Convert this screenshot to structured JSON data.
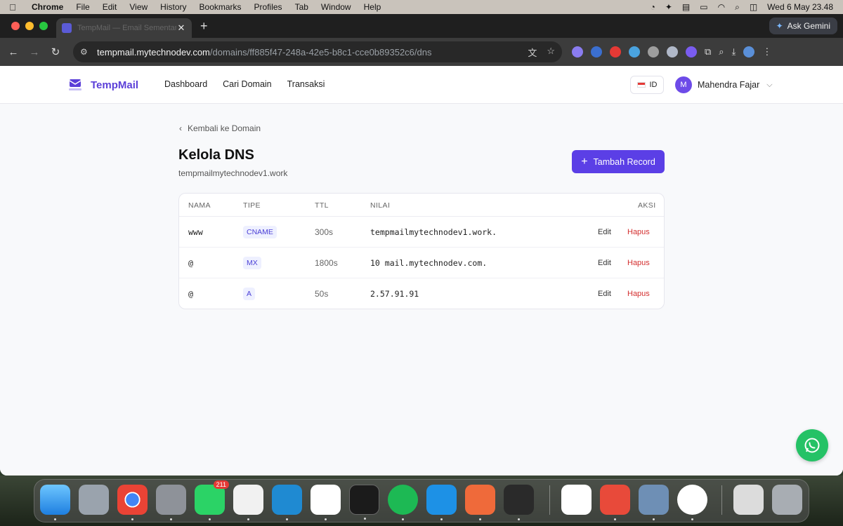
{
  "menubar": {
    "app_name": "Chrome",
    "items": [
      "File",
      "Edit",
      "View",
      "History",
      "Bookmarks",
      "Profiles",
      "Tab",
      "Window",
      "Help"
    ],
    "datetime": "Wed 6 May  23.48"
  },
  "browser": {
    "tab_title": "TempMail — Email Sementara",
    "ask_gemini": "Ask Gemini",
    "url_host": "tempmail.mytechnodev.com",
    "url_path": "/domains/ff885f47-248a-42e5-b8c1-cce0b89352c6/dns"
  },
  "app": {
    "logo_text": "TempMail",
    "nav": [
      "Dashboard",
      "Cari Domain",
      "Transaksi"
    ],
    "lang": "ID",
    "user_initial": "M",
    "user_name": "Mahendra Fajar"
  },
  "main": {
    "back_label": "Kembali ke Domain",
    "title": "Kelola DNS",
    "domain": "tempmailmytechnodev1.work",
    "add_button": "Tambah Record",
    "columns": [
      "NAMA",
      "TIPE",
      "TTL",
      "NILAI",
      "AKSI"
    ],
    "records": [
      {
        "name": "www",
        "type": "CNAME",
        "ttl": "300s",
        "value": "tempmailmytechnodev1.work.",
        "edit": "Edit",
        "delete": "Hapus"
      },
      {
        "name": "@",
        "type": "MX",
        "ttl": "1800s",
        "value": "10 mail.mytechnodev.com.",
        "edit": "Edit",
        "delete": "Hapus"
      },
      {
        "name": "@",
        "type": "A",
        "ttl": "50s",
        "value": "2.57.91.91",
        "edit": "Edit",
        "delete": "Hapus"
      }
    ]
  },
  "dock": {
    "whatsapp_badge": "211"
  },
  "colors": {
    "accent": "#5b3fe6",
    "danger": "#d32f2f",
    "whatsapp": "#25c266"
  }
}
